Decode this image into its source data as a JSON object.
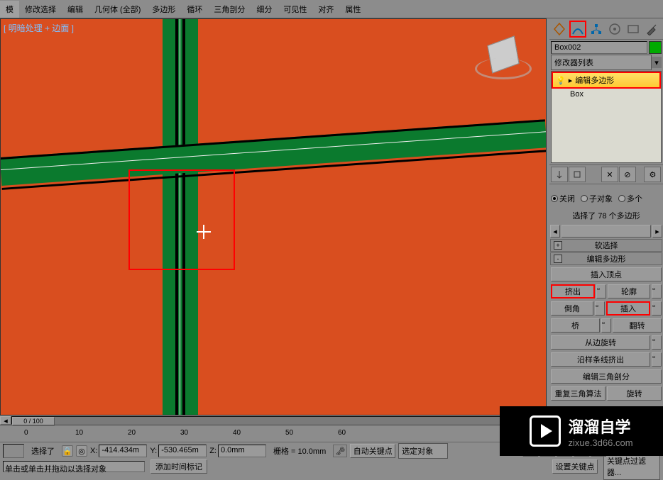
{
  "menu": [
    "模",
    "修改选择",
    "编辑",
    "几何体 (全部)",
    "多边形",
    "循环",
    "三角剖分",
    "细分",
    "可见性",
    "对齐",
    "属性"
  ],
  "viewport_label": "[ 明暗处理 + 边面 ]",
  "right_panel": {
    "object_name": "Box002",
    "modifier_list_label": "修改器列表",
    "stack": [
      {
        "name": "编辑多边形",
        "active": true
      },
      {
        "name": "Box",
        "active": false
      }
    ],
    "selection": {
      "modes": [
        "关闭",
        "子对象",
        "多个"
      ],
      "info": "选择了 78 个多边形"
    },
    "rollouts": {
      "soft_sel": "软选择",
      "edit_poly": "编辑多边形",
      "insert_vertex": "插入顶点",
      "extrude": "挤出",
      "outline": "轮廓",
      "bevel": "倒角",
      "inset": "插入",
      "bridge": "桥",
      "flip": "翻转",
      "from_edge_rotate": "从边旋转",
      "along_spline_extrude": "沿样条线挤出",
      "edit_tri": "编辑三角剖分",
      "retri": "重复三角算法",
      "rotate": "旋转"
    }
  },
  "timeline": {
    "slider": "0 / 100",
    "ticks": [
      "0",
      "10",
      "20",
      "30",
      "40",
      "50",
      "60"
    ]
  },
  "status": {
    "selected_label": "选择了",
    "x": "-414.434m",
    "y": "-530.465m",
    "z": "0.0mm",
    "grid": "栅格 = 10.0mm",
    "auto_key": "自动关键点",
    "selected_obj": "选定对象",
    "set_key": "设置关键点",
    "key_filter": "关键点过滤器...",
    "hint": "单击或单击并拖动以选择对象",
    "add_time": "添加时间标记"
  },
  "watermark": {
    "brand": "溜溜自学",
    "url": "zixue.3d66.com"
  }
}
